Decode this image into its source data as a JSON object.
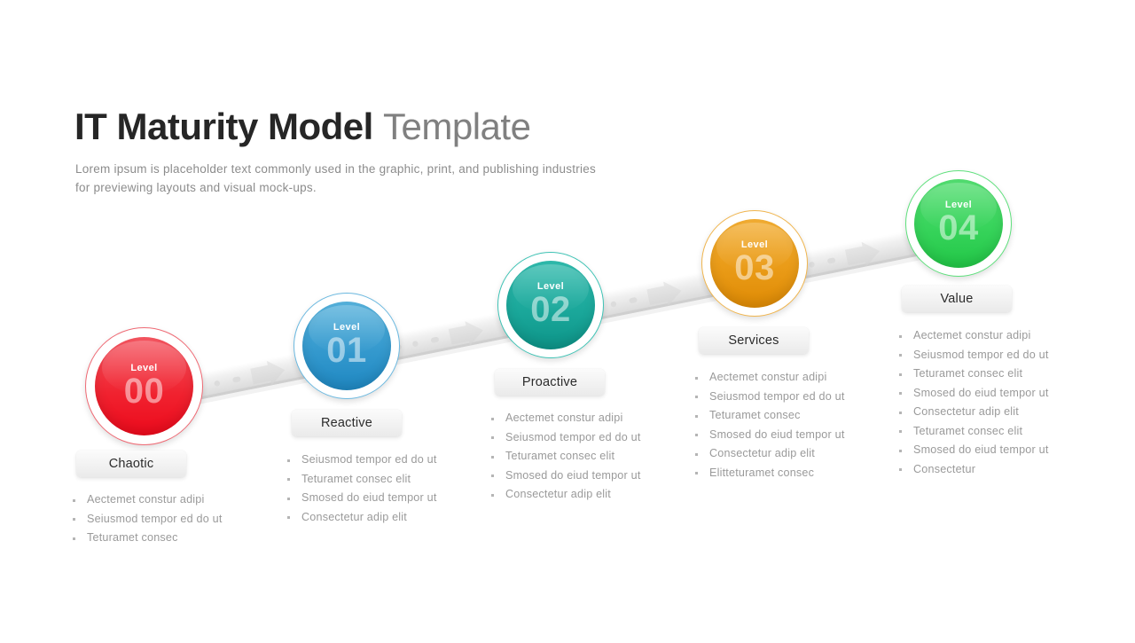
{
  "header": {
    "title_strong": "IT Maturity Model",
    "title_light": "Template",
    "subtitle": "Lorem ipsum is placeholder text commonly used in the graphic, print, and publishing industries for previewing layouts and visual mock-ups."
  },
  "colors": {
    "level00": "#ef1b2d",
    "level01": "#3398cd",
    "level02": "#1aa79a",
    "level03": "#e99a16",
    "level04": "#36d35a",
    "ribbon": "#e6e6e6",
    "chip_text": "#2b2b2b",
    "bullet_text": "#9a9a9a"
  },
  "stages": [
    {
      "level_word": "Level",
      "level_number": "00",
      "label": "Chaotic",
      "accent": "#ef1b2d",
      "gradient_top": "#f45560",
      "gradient_bottom": "#ed0a1c",
      "bullets": [
        "Aectemet constur adipi",
        "Seiusmod tempor ed do ut",
        "Teturamet consec"
      ]
    },
    {
      "level_word": "Level",
      "level_number": "01",
      "label": "Reactive",
      "accent": "#3398cd",
      "gradient_top": "#51aed9",
      "gradient_bottom": "#2089c2",
      "bullets": [
        "Seiusmod tempor ed do ut",
        "Teturamet consec elit",
        "Smosed do eiud tempor ut",
        "Consectetur adip elit"
      ]
    },
    {
      "level_word": "Level",
      "level_number": "02",
      "label": "Proactive",
      "accent": "#1aa79a",
      "gradient_top": "#2cb6a8",
      "gradient_bottom": "#0f988c",
      "bullets": [
        "Aectemet constur adipi",
        "Seiusmod tempor ed do ut",
        "Teturamet consec elit",
        "Smosed do eiud tempor ut",
        "Consectetur adip elit"
      ]
    },
    {
      "level_word": "Level",
      "level_number": "03",
      "label": "Services",
      "accent": "#e99a16",
      "gradient_top": "#f0a92b",
      "gradient_bottom": "#e08c07",
      "bullets": [
        "Aectemet constur adipi",
        "Seiusmod tempor ed do ut",
        "Teturamet consec",
        "Smosed do eiud tempor ut",
        "Consectetur adip elit",
        "Elitteturamet consec"
      ]
    },
    {
      "level_word": "Level",
      "level_number": "04",
      "label": "Value",
      "accent": "#36d35a",
      "gradient_top": "#50dd6e",
      "gradient_bottom": "#27c94b",
      "bullets": [
        "Aectemet constur adipi",
        "Seiusmod tempor ed do ut",
        "Teturamet consec elit",
        "Smosed do eiud tempor ut",
        "Consectetur adip elit",
        "Teturamet consec elit",
        "Smosed do eiud tempor ut",
        "Consectetur"
      ]
    }
  ]
}
